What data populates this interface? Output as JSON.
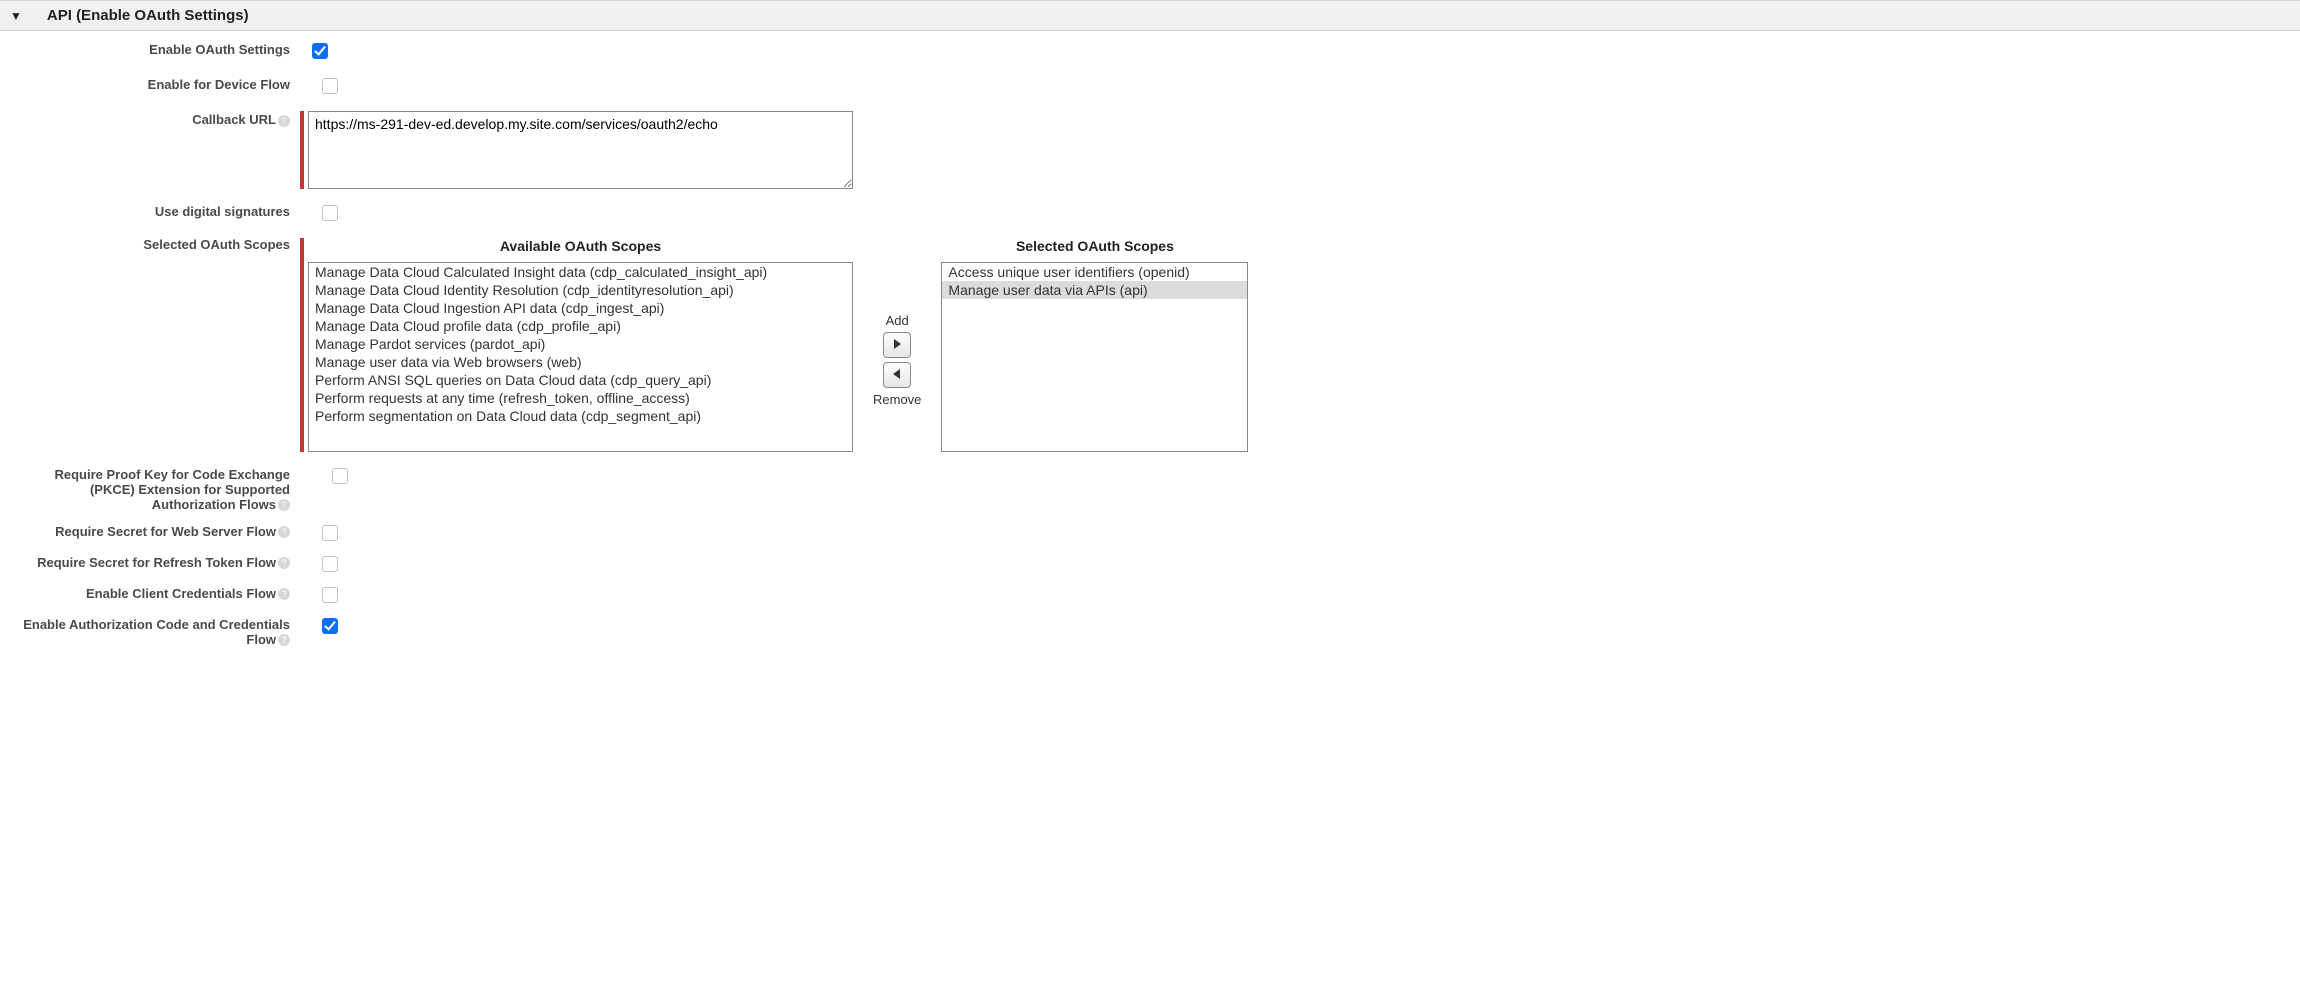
{
  "section": {
    "title": "API (Enable OAuth Settings)"
  },
  "labels": {
    "enable_oauth": "Enable OAuth Settings",
    "enable_device_flow": "Enable for Device Flow",
    "callback_url": "Callback URL",
    "use_digital_signatures": "Use digital signatures",
    "selected_oauth_scopes": "Selected OAuth Scopes",
    "require_pkce": "Require Proof Key for Code Exchange (PKCE) Extension for Supported Authorization Flows",
    "require_secret_web": "Require Secret for Web Server Flow",
    "require_secret_refresh": "Require Secret for Refresh Token Flow",
    "enable_client_creds": "Enable Client Credentials Flow",
    "enable_auth_code_creds": "Enable Authorization Code and Credentials Flow"
  },
  "values": {
    "enable_oauth": true,
    "enable_device_flow": false,
    "callback_url": "https://ms-291-dev-ed.develop.my.site.com/services/oauth2/echo",
    "use_digital_signatures": false,
    "require_pkce": false,
    "require_secret_web": false,
    "require_secret_refresh": false,
    "enable_client_creds": false,
    "enable_auth_code_creds": true
  },
  "scopes": {
    "available_title": "Available OAuth Scopes",
    "selected_title": "Selected OAuth Scopes",
    "add_label": "Add",
    "remove_label": "Remove",
    "available": [
      "Manage Data Cloud Calculated Insight data (cdp_calculated_insight_api)",
      "Manage Data Cloud Identity Resolution (cdp_identityresolution_api)",
      "Manage Data Cloud Ingestion API data (cdp_ingest_api)",
      "Manage Data Cloud profile data (cdp_profile_api)",
      "Manage Pardot services (pardot_api)",
      "Manage user data via Web browsers (web)",
      "Perform ANSI SQL queries on Data Cloud data (cdp_query_api)",
      "Perform requests at any time (refresh_token, offline_access)",
      "Perform segmentation on Data Cloud data (cdp_segment_api)"
    ],
    "selected": [
      "Access unique user identifiers (openid)",
      "Manage user data via APIs (api)"
    ],
    "selected_highlight_index": 1
  }
}
